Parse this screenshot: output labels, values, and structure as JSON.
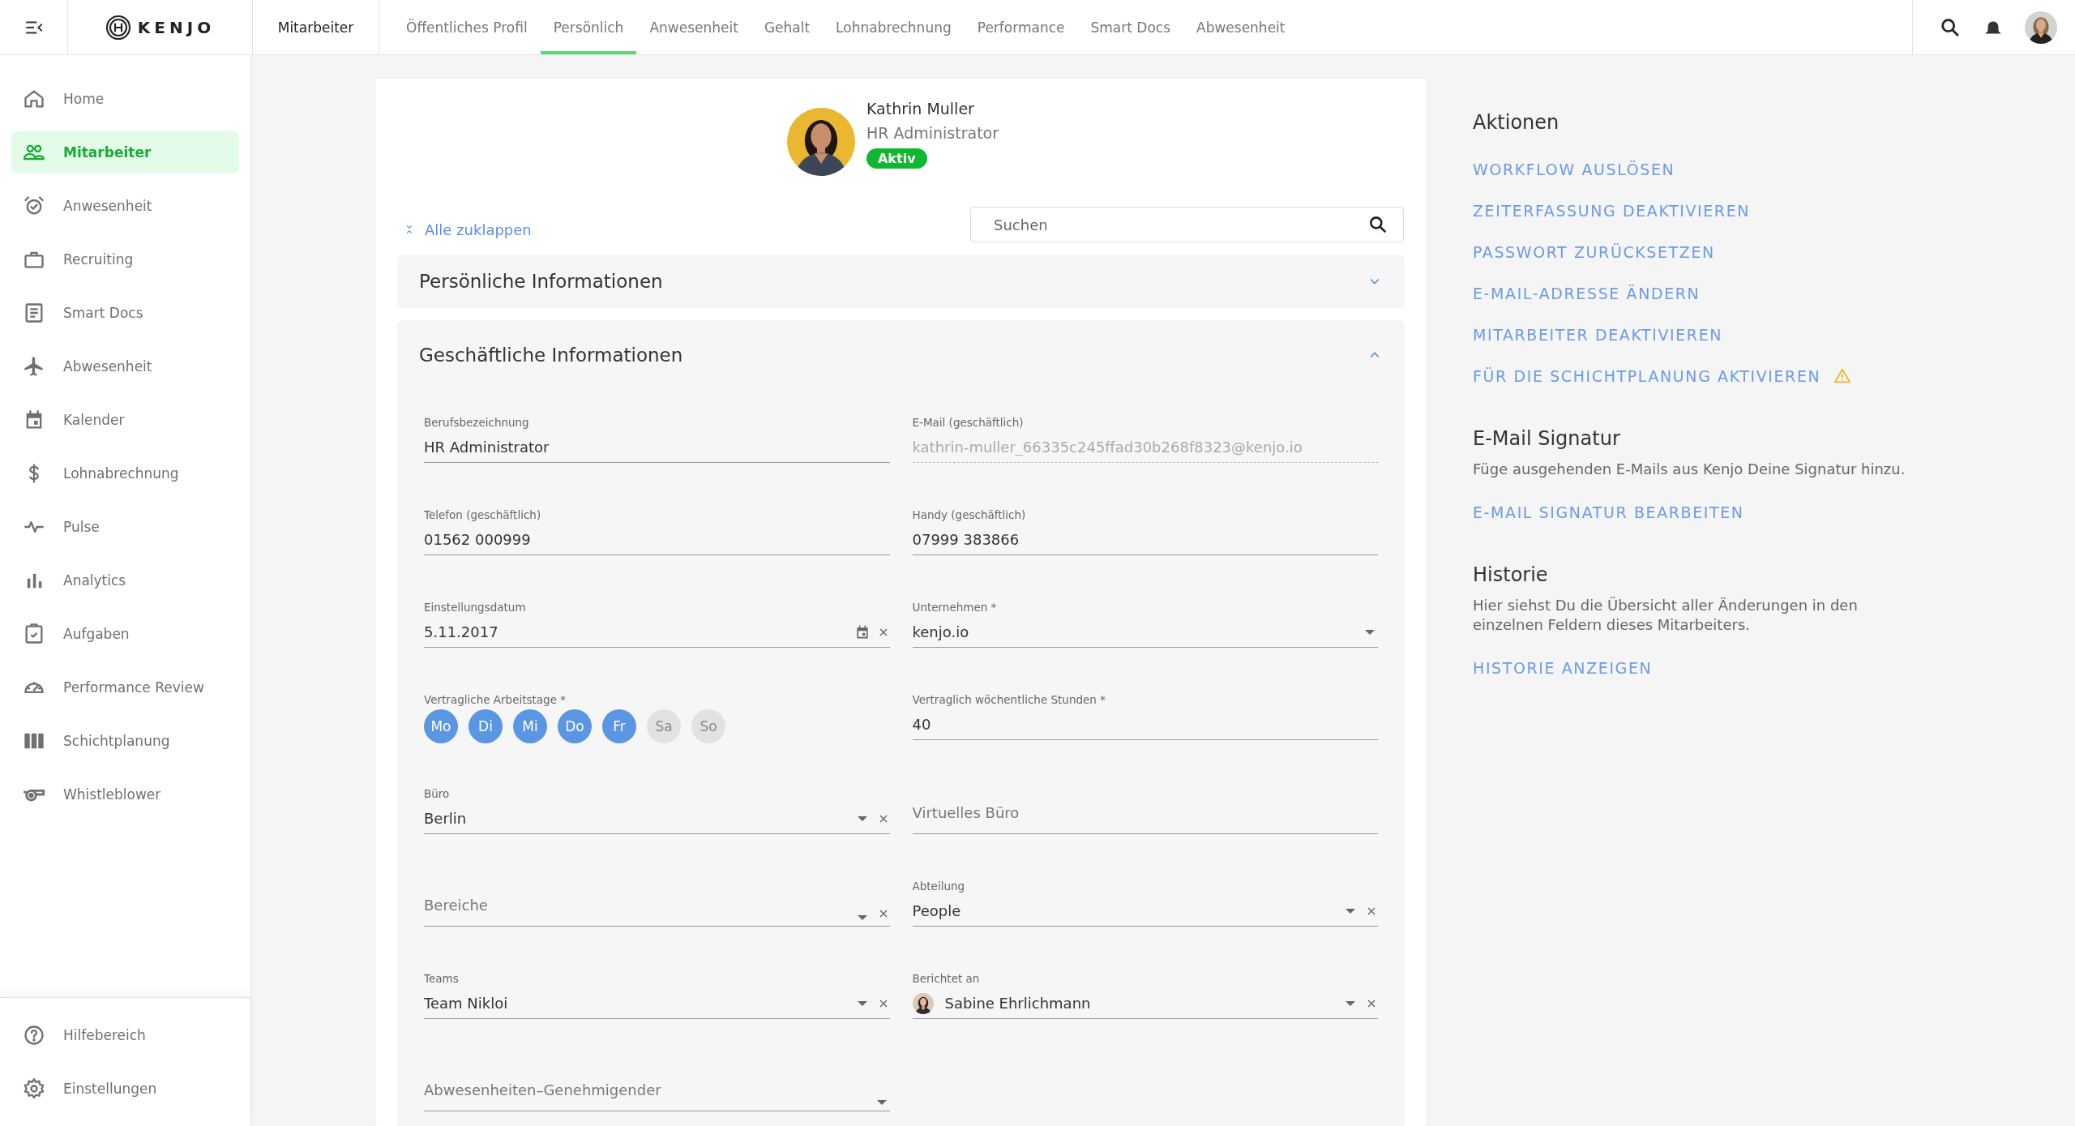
{
  "topbar": {
    "logo": "KENJO",
    "section": "Mitarbeiter",
    "tabs": [
      {
        "label": "Öffentliches Profil",
        "selected": false
      },
      {
        "label": "Persönlich",
        "selected": true
      },
      {
        "label": "Anwesenheit",
        "selected": false
      },
      {
        "label": "Gehalt",
        "selected": false
      },
      {
        "label": "Lohnabrechnung",
        "selected": false
      },
      {
        "label": "Performance",
        "selected": false
      },
      {
        "label": "Smart Docs",
        "selected": false
      },
      {
        "label": "Abwesenheit",
        "selected": false
      }
    ]
  },
  "sidebar": {
    "items": [
      {
        "label": "Home",
        "selected": false
      },
      {
        "label": "Mitarbeiter",
        "selected": true
      },
      {
        "label": "Anwesenheit",
        "selected": false
      },
      {
        "label": "Recruiting",
        "selected": false
      },
      {
        "label": "Smart Docs",
        "selected": false
      },
      {
        "label": "Abwesenheit",
        "selected": false
      },
      {
        "label": "Kalender",
        "selected": false
      },
      {
        "label": "Lohnabrechnung",
        "selected": false
      },
      {
        "label": "Pulse",
        "selected": false
      },
      {
        "label": "Analytics",
        "selected": false
      },
      {
        "label": "Aufgaben",
        "selected": false
      },
      {
        "label": "Performance Review",
        "selected": false
      },
      {
        "label": "Schichtplanung",
        "selected": false
      },
      {
        "label": "Whistleblower",
        "selected": false
      }
    ],
    "footer_items": [
      {
        "label": "Hilfebereich",
        "selected": false
      },
      {
        "label": "Einstellungen",
        "selected": false
      }
    ]
  },
  "profile": {
    "name": "Kathrin Muller",
    "role": "HR Administrator",
    "status": "Aktiv"
  },
  "collapse_all": "Alle zuklappen",
  "search": {
    "placeholder": "Suchen"
  },
  "sections": [
    {
      "title": "Persönliche Informationen",
      "expanded": false
    },
    {
      "title": "Geschäftliche Informationen",
      "expanded": true,
      "rows": [
        {
          "fields": [
            {
              "kind": "text",
              "label": "Berufsbezeichnung",
              "value": "HR Administrator",
              "clearable": false
            },
            {
              "kind": "readonly",
              "label": "E-Mail (geschäftlich)",
              "value": "kathrin-muller_66335c245ffad30b268f8323@kenjo.io",
              "clearable": false
            }
          ]
        },
        {
          "fields": [
            {
              "kind": "text",
              "label": "Telefon (geschäftlich)",
              "value": "01562 000999",
              "clearable": false
            },
            {
              "kind": "text",
              "label": "Handy (geschäftlich)",
              "value": "07999 383866",
              "clearable": false
            }
          ]
        },
        {
          "fields": [
            {
              "kind": "date",
              "label": "Einstellungsdatum",
              "value": "5.11.2017",
              "clearable": true
            },
            {
              "kind": "select",
              "label": "Unternehmen *",
              "value": "kenjo.io",
              "clearable": false
            }
          ]
        },
        {
          "fields": [
            {
              "kind": "days",
              "label": "Vertragliche Arbeitstage *",
              "days": [
                {
                  "label": "Mo",
                  "selected": true
                },
                {
                  "label": "Di",
                  "selected": true
                },
                {
                  "label": "Mi",
                  "selected": true
                },
                {
                  "label": "Do",
                  "selected": true
                },
                {
                  "label": "Fr",
                  "selected": true
                },
                {
                  "label": "Sa",
                  "selected": false
                },
                {
                  "label": "So",
                  "selected": false
                }
              ]
            },
            {
              "kind": "text",
              "label": "Vertraglich wöchentliche Stunden *",
              "value": "40",
              "clearable": false
            }
          ]
        },
        {
          "fields": [
            {
              "kind": "select",
              "label": "Büro",
              "value": "Berlin",
              "clearable": true
            },
            {
              "kind": "text",
              "placeholder": "Virtuelles Büro",
              "clearable": false
            }
          ]
        },
        {
          "fields": [
            {
              "kind": "select",
              "placeholder": "Bereiche",
              "clearable": true
            },
            {
              "kind": "select",
              "label": "Abteilung",
              "value": "People",
              "clearable": true
            }
          ]
        },
        {
          "fields": [
            {
              "kind": "select",
              "label": "Teams",
              "value": "Team Nikloi",
              "clearable": true
            },
            {
              "kind": "person",
              "label": "Berichtet an",
              "value": "Sabine Ehrlichmann",
              "clearable": true
            }
          ]
        },
        {
          "fields": [
            {
              "kind": "select",
              "placeholder": "Abwesenheiten–Genehmigender",
              "clearable": false
            }
          ]
        }
      ]
    }
  ],
  "actions": {
    "title": "Aktionen",
    "links": [
      {
        "label": "WORKFLOW AUSLÖSEN",
        "warning": false
      },
      {
        "label": "ZEITERFASSUNG DEAKTIVIEREN",
        "warning": false
      },
      {
        "label": "PASSWORT ZURÜCKSETZEN",
        "warning": false
      },
      {
        "label": "E-MAIL-ADRESSE ÄNDERN",
        "warning": false
      },
      {
        "label": "MITARBEITER DEAKTIVIEREN",
        "warning": false
      },
      {
        "label": "FÜR DIE SCHICHTPLANUNG AKTIVIEREN",
        "warning": true
      }
    ]
  },
  "signature": {
    "title": "E-Mail Signatur",
    "description": "Füge ausgehenden E-Mails aus Kenjo Deine Signatur hinzu.",
    "link": "E-MAIL SIGNATUR BEARBEITEN"
  },
  "history": {
    "title": "Historie",
    "description": "Hier siehst Du die Übersicht aller Änderungen in den einzelnen Feldern dieses Mitarbeiters.",
    "link": "HISTORIE ANZEIGEN"
  }
}
